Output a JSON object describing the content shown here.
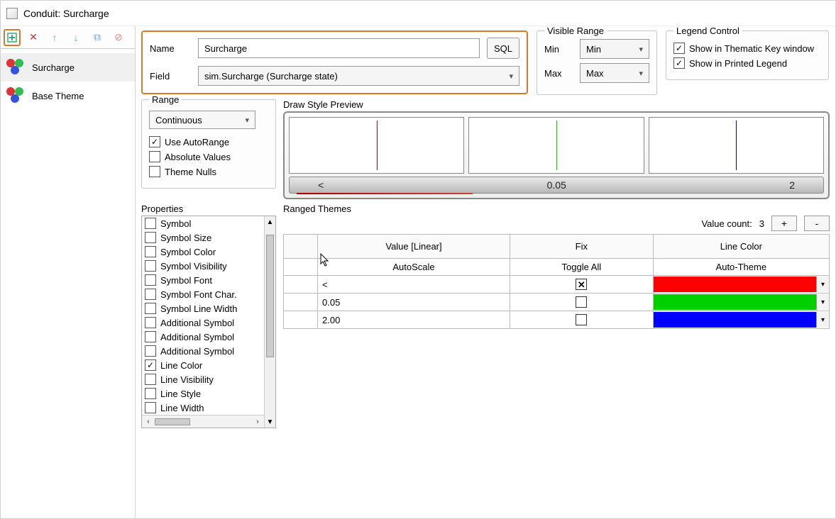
{
  "title": "Conduit: Surcharge",
  "toolbar_icons": [
    "add",
    "delete",
    "up",
    "down",
    "copy",
    "cancel"
  ],
  "themes": [
    {
      "label": "Surcharge",
      "selected": true
    },
    {
      "label": "Base Theme",
      "selected": false
    }
  ],
  "name_box": {
    "name_label": "Name",
    "name_value": "Surcharge",
    "sql_button": "SQL",
    "field_label": "Field",
    "field_value": "sim.Surcharge (Surcharge state)"
  },
  "visible_range": {
    "title": "Visible Range",
    "min_label": "Min",
    "min_value": "Min",
    "max_label": "Max",
    "max_value": "Max"
  },
  "legend_control": {
    "title": "Legend Control",
    "show_thematic": "Show in Thematic Key window",
    "show_printed": "Show in Printed Legend"
  },
  "range_group": {
    "title": "Range",
    "mode": "Continuous",
    "use_autorange": "Use AutoRange",
    "absolute_values": "Absolute Values",
    "theme_nulls": "Theme Nulls"
  },
  "preview": {
    "title": "Draw Style Preview",
    "ticks": [
      "<",
      "0.05",
      "2"
    ]
  },
  "properties": {
    "title": "Properties",
    "items": [
      {
        "label": "Symbol",
        "checked": false
      },
      {
        "label": "Symbol Size",
        "checked": false
      },
      {
        "label": "Symbol Color",
        "checked": false
      },
      {
        "label": "Symbol Visibility",
        "checked": false
      },
      {
        "label": "Symbol Font",
        "checked": false
      },
      {
        "label": "Symbol Font Char.",
        "checked": false
      },
      {
        "label": "Symbol Line Width",
        "checked": false
      },
      {
        "label": "Additional Symbol",
        "checked": false
      },
      {
        "label": "Additional Symbol",
        "checked": false
      },
      {
        "label": "Additional Symbol",
        "checked": false
      },
      {
        "label": "Line Color",
        "checked": true
      },
      {
        "label": "Line Visibility",
        "checked": false
      },
      {
        "label": "Line Style",
        "checked": false
      },
      {
        "label": "Line Width",
        "checked": false
      }
    ]
  },
  "ranged_themes": {
    "title": "Ranged Themes",
    "value_count_label": "Value count:",
    "value_count": "3",
    "plus": "+",
    "minus": "-",
    "col_value": "Value [Linear]",
    "col_fix": "Fix",
    "col_color": "Line Color",
    "sub_auto": "AutoScale",
    "sub_toggle": "Toggle All",
    "sub_theme": "Auto-Theme",
    "rows": [
      {
        "value": "<",
        "fix": true,
        "color": "#ff0000"
      },
      {
        "value": "0.05",
        "fix": false,
        "color": "#00d000"
      },
      {
        "value": "2.00",
        "fix": false,
        "color": "#0000ff"
      }
    ]
  }
}
